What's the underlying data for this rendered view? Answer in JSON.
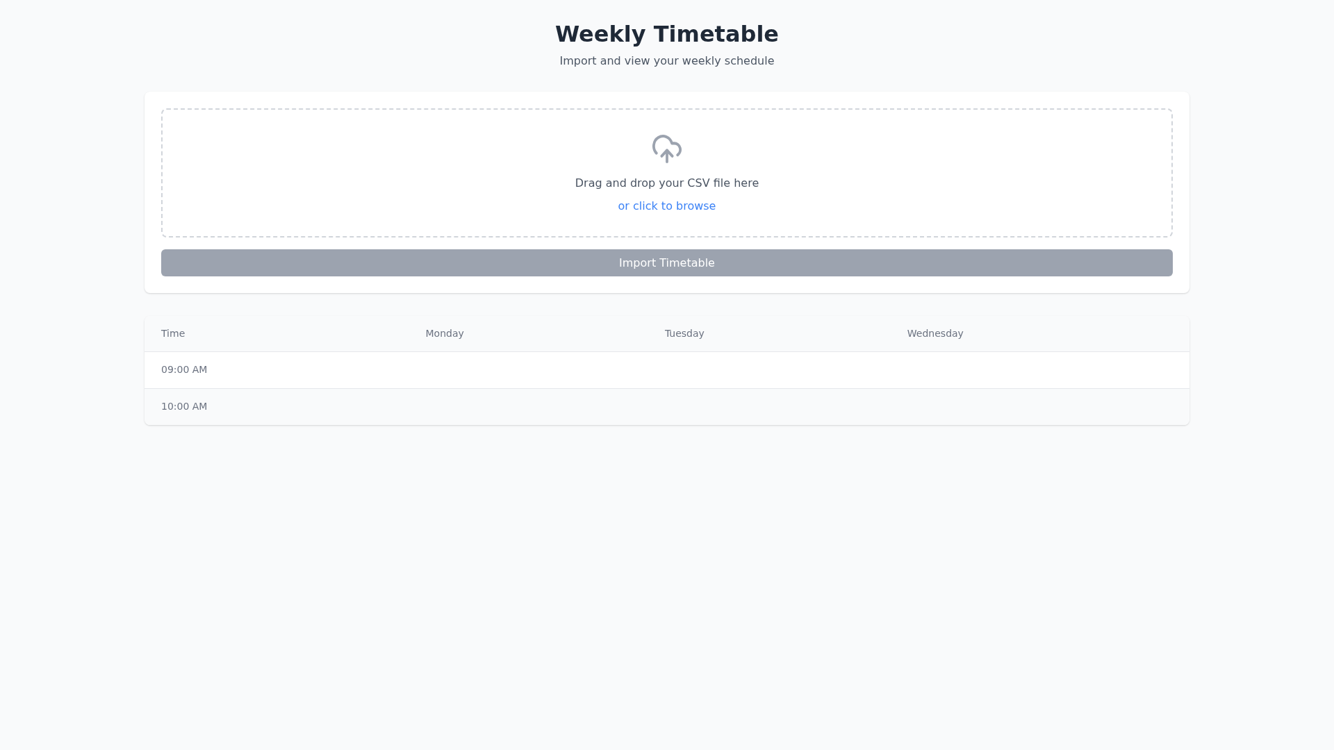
{
  "header": {
    "title": "Weekly Timetable",
    "subtitle": "Import and view your weekly schedule"
  },
  "upload": {
    "instruction": "Drag and drop your CSV file here",
    "browse_link": "or click to browse",
    "button": {
      "label": "Import Timetable",
      "disabled": true
    }
  },
  "table": {
    "columns": [
      "Time",
      "Monday",
      "Tuesday",
      "Wednesday"
    ],
    "rows": [
      {
        "time": "09:00 AM"
      },
      {
        "time": "10:00 AM"
      }
    ]
  }
}
